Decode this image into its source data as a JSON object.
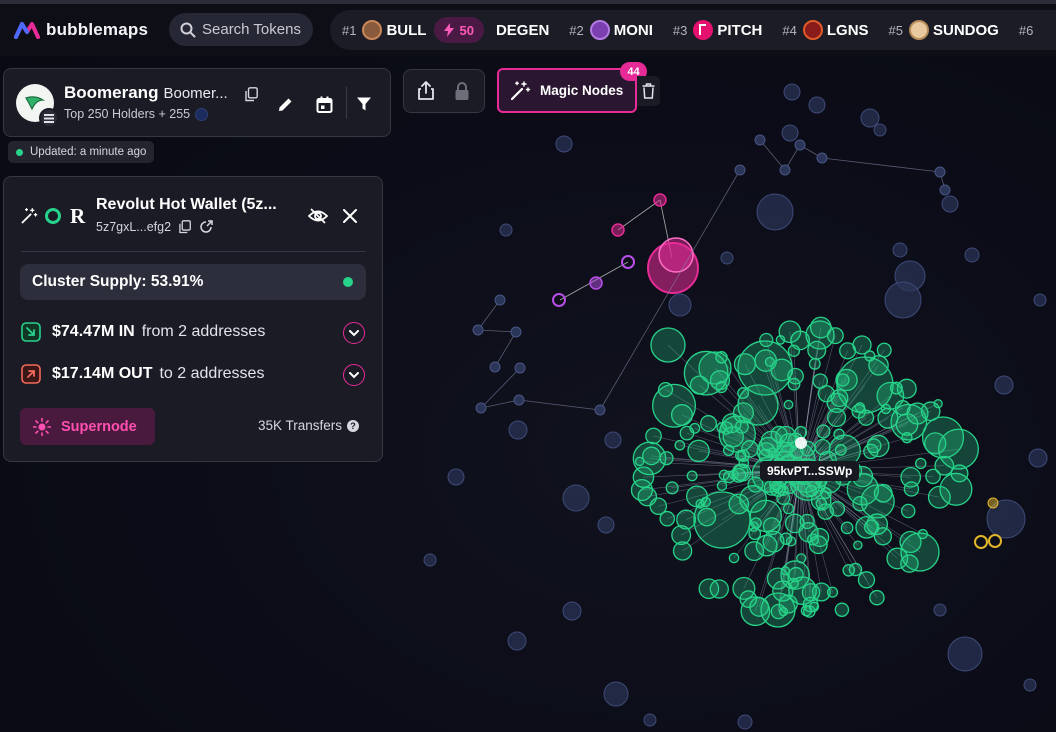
{
  "app": {
    "name": "bubblemaps"
  },
  "search": {
    "placeholder": "Search Tokens"
  },
  "trending": [
    {
      "rank": "#1",
      "name": "BULL",
      "boost": "50",
      "color": "#8a5a3c"
    },
    {
      "rank": "",
      "name": "DEGEN",
      "color": ""
    },
    {
      "rank": "#2",
      "name": "MONI",
      "color": "#7b3fb0"
    },
    {
      "rank": "#3",
      "name": "PITCH",
      "color": "#e6106e"
    },
    {
      "rank": "#4",
      "name": "LGNS",
      "color": "#8a1b1b"
    },
    {
      "rank": "#5",
      "name": "SUNDOG",
      "color": "#e8c9a0"
    },
    {
      "rank": "#6",
      "name": "",
      "color": ""
    }
  ],
  "token": {
    "name": "Boomerang",
    "symbol": "Boomer...",
    "subtitle": "Top 250 Holders + 255",
    "updated": "Updated: a minute ago"
  },
  "toolbar": {
    "magic_label": "Magic Nodes",
    "magic_count": "44"
  },
  "wallet": {
    "name": "Revolut Hot Wallet (5z...",
    "address": "5z7gxL...efg2",
    "cluster_supply": "Cluster Supply: 53.91%",
    "in_amount": "$74.47M IN",
    "in_detail": "from 2 addresses",
    "out_amount": "$17.14M OUT",
    "out_detail": "to 2 addresses",
    "supernode_label": "Supernode",
    "transfers": "35K Transfers"
  },
  "graph": {
    "center_label": "95kvPT...SSWp",
    "colors": {
      "green": "#27d38a",
      "pink": "#e62b97",
      "purple": "#b84ee8",
      "blue": "#2b3558",
      "yellow": "#e3b52a"
    }
  }
}
